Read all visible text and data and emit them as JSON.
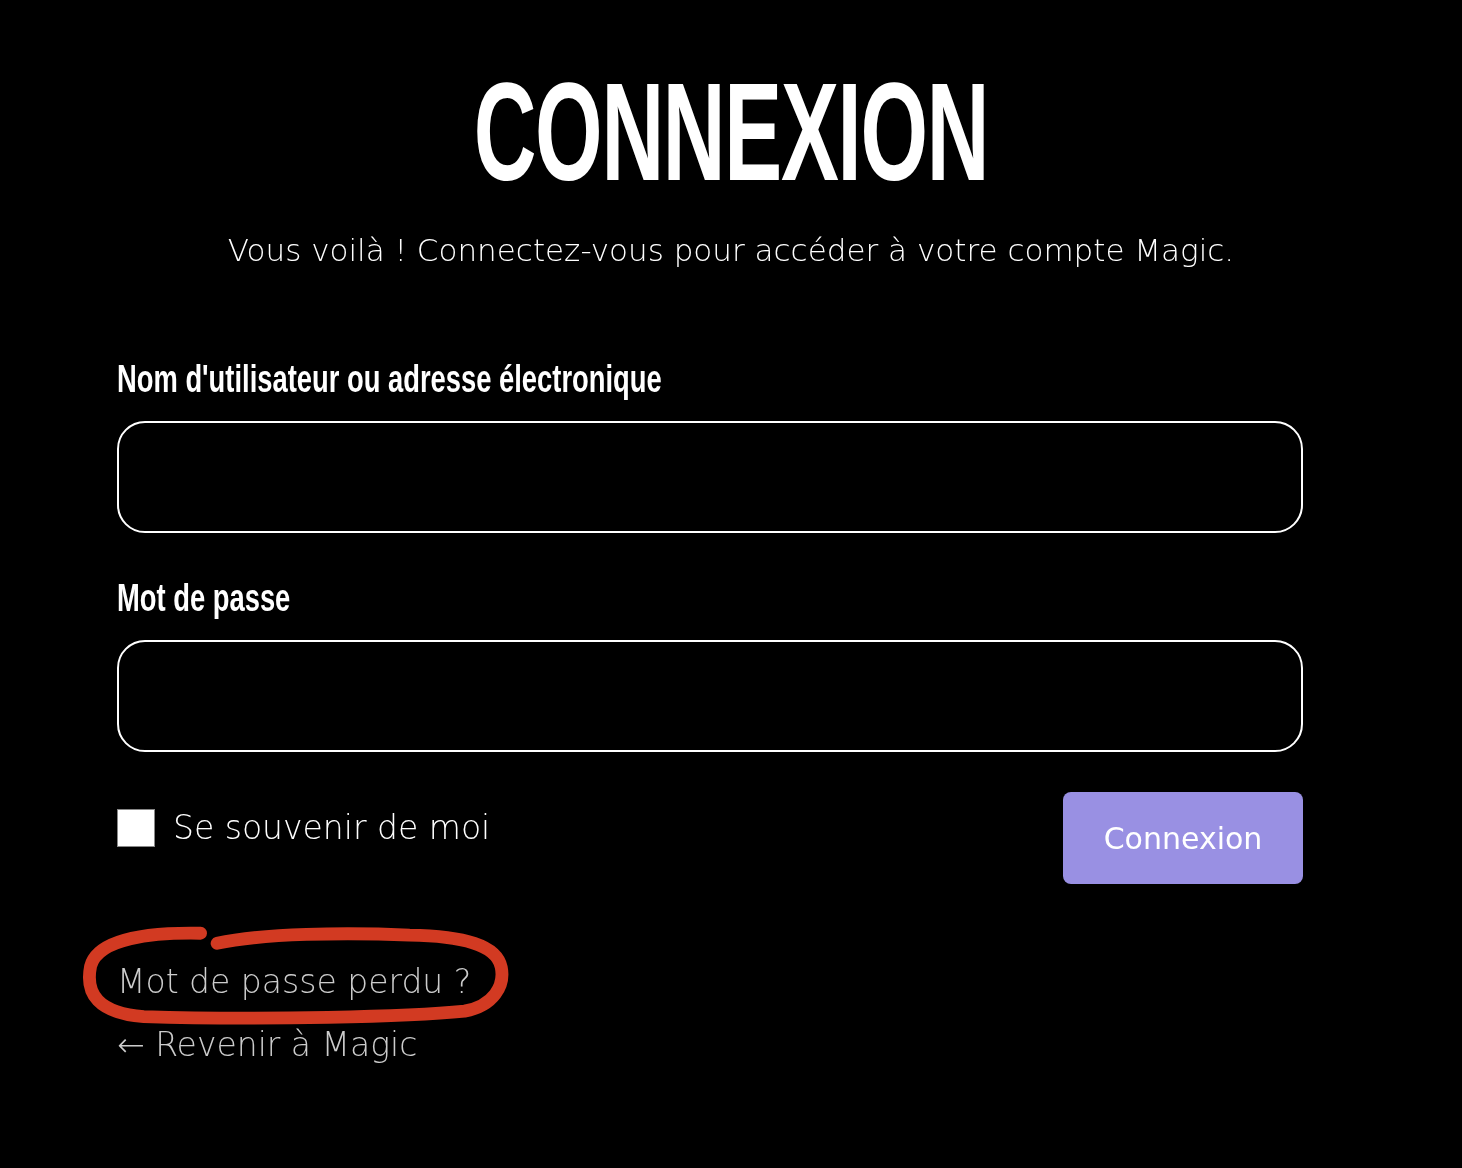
{
  "title": "CONNEXION",
  "subtitle": "Vous voilà ! Connectez-vous pour accéder à votre compte Magic.",
  "fields": [
    {
      "label": "Nom d'utilisateur ou adresse électronique"
    },
    {
      "label": "Mot de passe"
    }
  ],
  "remember": {
    "label": "Se souvenir de moi",
    "checked": false
  },
  "submit": {
    "label": "Connexion"
  },
  "links": [
    {
      "label": "Mot de passe perdu ?"
    },
    {
      "label": "← Revenir à Magic"
    }
  ]
}
